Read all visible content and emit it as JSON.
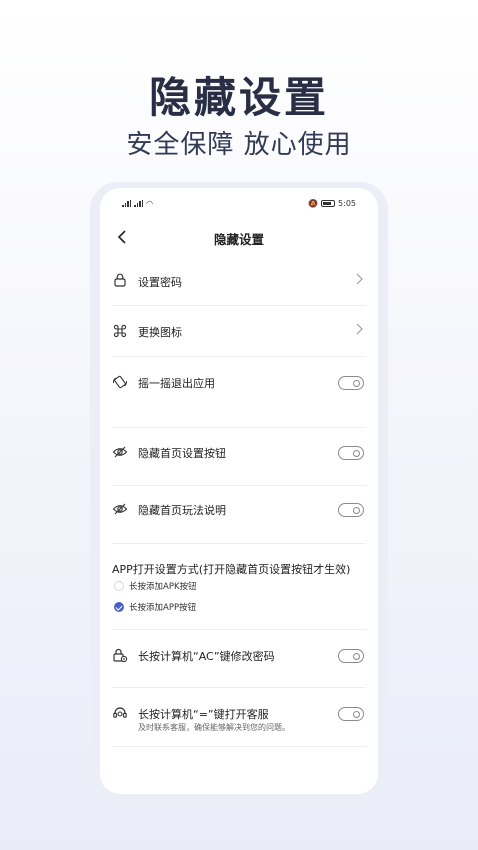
{
  "hero": {
    "title": "隐藏设置",
    "subtitle": "安全保障 放心使用"
  },
  "status_bar": {
    "left_indicators": "⁴⁶ᴵ",
    "time": "5:05",
    "battery_level": "85"
  },
  "nav": {
    "back_icon": "chevron-left-icon",
    "title": "隐藏设置"
  },
  "settings": {
    "set_password": {
      "label": "设置密码",
      "icon": "lock-icon"
    },
    "change_icon": {
      "label": "更换图标",
      "icon": "command-icon"
    },
    "shake_exit": {
      "label": "摇一摇退出应用",
      "icon": "shake-icon",
      "enabled": false
    },
    "hide_settings_btn": {
      "label": "隐藏首页设置按钮",
      "icon": "eye-off-icon",
      "enabled": false
    },
    "hide_guide": {
      "label": "隐藏首页玩法说明",
      "icon": "eye-off-icon",
      "enabled": false
    },
    "open_method": {
      "title": "APP打开设置方式(打开隐藏首页设置按钮才生效)",
      "options": [
        {
          "label": "长按添加APK按钮",
          "checked": false
        },
        {
          "label": "长按添加APP按钮",
          "checked": true
        }
      ]
    },
    "ac_change_password": {
      "label": "长按计算机“AC”键修改密码",
      "icon": "lock-settings-icon",
      "enabled": false
    },
    "equals_support": {
      "label": "长按计算机“=”键打开客服",
      "description": "及时联系客服，确保能够解决到您的问题。",
      "icon": "headset-icon",
      "enabled": false
    }
  },
  "colors": {
    "accent": "#4b5ec9",
    "title": "#2a2e45",
    "text": "#222222",
    "divider": "#eeeef2"
  }
}
